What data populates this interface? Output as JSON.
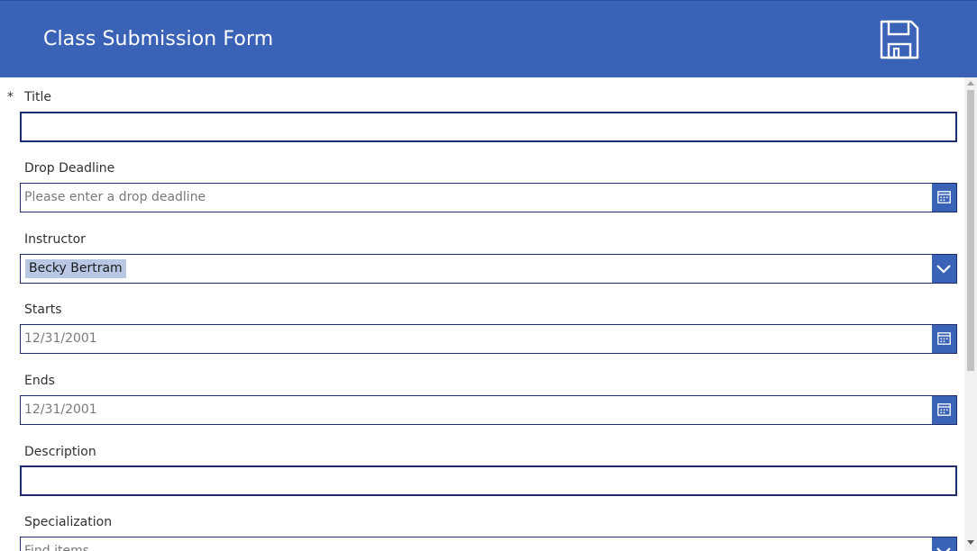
{
  "header": {
    "title": "Class Submission Form",
    "save_icon": "save-icon",
    "background_color": "#3a63b8"
  },
  "form": {
    "required_marker": "*",
    "fields": {
      "title": {
        "label": "Title",
        "value": ""
      },
      "drop_deadline": {
        "label": "Drop Deadline",
        "placeholder": "Please enter a drop deadline",
        "icon": "calendar-icon"
      },
      "instructor": {
        "label": "Instructor",
        "selected": "Becky Bertram",
        "icon": "chevron-down-icon"
      },
      "starts": {
        "label": "Starts",
        "value": "12/31/2001",
        "icon": "calendar-icon"
      },
      "ends": {
        "label": "Ends",
        "value": "12/31/2001",
        "icon": "calendar-icon"
      },
      "description": {
        "label": "Description",
        "value": ""
      },
      "specialization": {
        "label": "Specialization",
        "placeholder": "Find items",
        "icon": "chevron-down-icon"
      }
    }
  }
}
